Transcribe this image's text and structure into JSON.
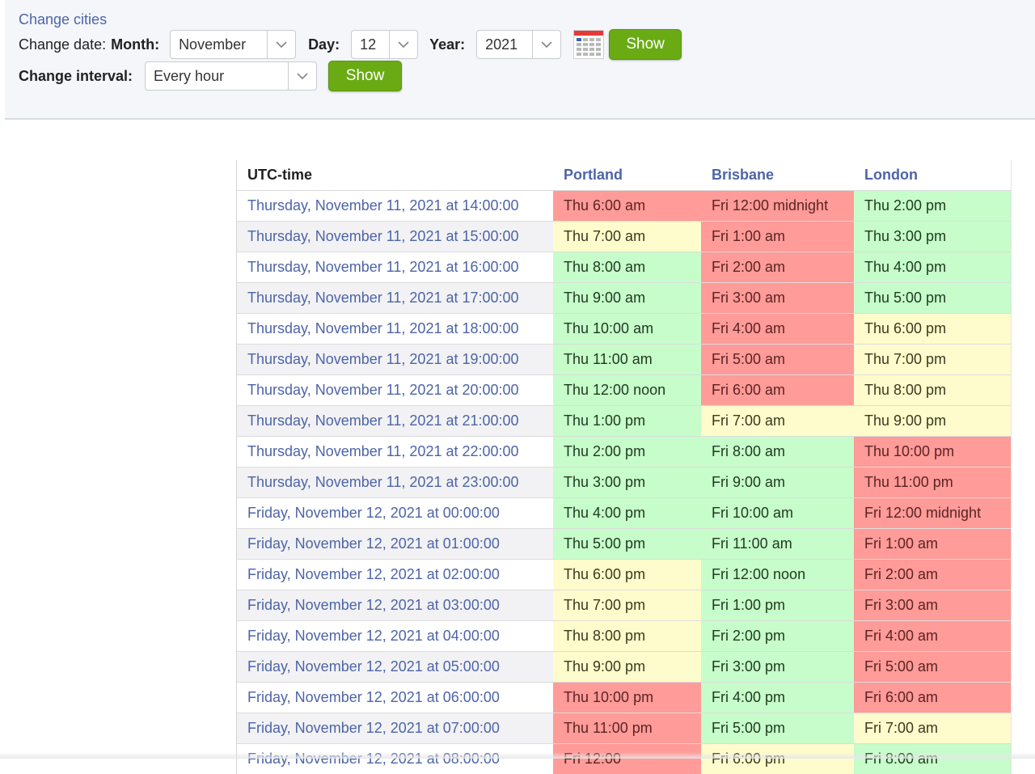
{
  "controls": {
    "change_cities_link": "Change cities",
    "change_date_label": "Change date:",
    "month_label": "Month:",
    "month_value": "November",
    "day_label": "Day:",
    "day_value": "12",
    "year_label": "Year:",
    "year_value": "2021",
    "show_date_button": "Show",
    "change_interval_label": "Change interval:",
    "interval_value": "Every hour",
    "show_interval_button": "Show"
  },
  "colors": {
    "accent_link": "#4d64a8",
    "button_green": "#6aab14",
    "cell_red": "#ff9b98",
    "cell_green": "#c7fccb",
    "cell_yellow": "#fefccc"
  },
  "table": {
    "headers": [
      "UTC-time",
      "Portland",
      "Brisbane",
      "London"
    ],
    "rows": [
      {
        "utc": "Thursday, November 11, 2021 at 14:00:00",
        "cells": [
          {
            "text": "Thu 6:00 am",
            "status": "red"
          },
          {
            "text": "Fri 12:00 midnight",
            "status": "red"
          },
          {
            "text": "Thu 2:00 pm",
            "status": "green"
          }
        ]
      },
      {
        "utc": "Thursday, November 11, 2021 at 15:00:00",
        "cells": [
          {
            "text": "Thu 7:00 am",
            "status": "yellow"
          },
          {
            "text": "Fri 1:00 am",
            "status": "red"
          },
          {
            "text": "Thu 3:00 pm",
            "status": "green"
          }
        ]
      },
      {
        "utc": "Thursday, November 11, 2021 at 16:00:00",
        "cells": [
          {
            "text": "Thu 8:00 am",
            "status": "green"
          },
          {
            "text": "Fri 2:00 am",
            "status": "red"
          },
          {
            "text": "Thu 4:00 pm",
            "status": "green"
          }
        ]
      },
      {
        "utc": "Thursday, November 11, 2021 at 17:00:00",
        "cells": [
          {
            "text": "Thu 9:00 am",
            "status": "green"
          },
          {
            "text": "Fri 3:00 am",
            "status": "red"
          },
          {
            "text": "Thu 5:00 pm",
            "status": "green"
          }
        ]
      },
      {
        "utc": "Thursday, November 11, 2021 at 18:00:00",
        "cells": [
          {
            "text": "Thu 10:00 am",
            "status": "green"
          },
          {
            "text": "Fri 4:00 am",
            "status": "red"
          },
          {
            "text": "Thu 6:00 pm",
            "status": "yellow"
          }
        ]
      },
      {
        "utc": "Thursday, November 11, 2021 at 19:00:00",
        "cells": [
          {
            "text": "Thu 11:00 am",
            "status": "green"
          },
          {
            "text": "Fri 5:00 am",
            "status": "red"
          },
          {
            "text": "Thu 7:00 pm",
            "status": "yellow"
          }
        ]
      },
      {
        "utc": "Thursday, November 11, 2021 at 20:00:00",
        "cells": [
          {
            "text": "Thu 12:00 noon",
            "status": "green"
          },
          {
            "text": "Fri 6:00 am",
            "status": "red"
          },
          {
            "text": "Thu 8:00 pm",
            "status": "yellow"
          }
        ]
      },
      {
        "utc": "Thursday, November 11, 2021 at 21:00:00",
        "cells": [
          {
            "text": "Thu 1:00 pm",
            "status": "green"
          },
          {
            "text": "Fri 7:00 am",
            "status": "yellow"
          },
          {
            "text": "Thu 9:00 pm",
            "status": "yellow"
          }
        ]
      },
      {
        "utc": "Thursday, November 11, 2021 at 22:00:00",
        "cells": [
          {
            "text": "Thu 2:00 pm",
            "status": "green"
          },
          {
            "text": "Fri 8:00 am",
            "status": "green"
          },
          {
            "text": "Thu 10:00 pm",
            "status": "red"
          }
        ]
      },
      {
        "utc": "Thursday, November 11, 2021 at 23:00:00",
        "cells": [
          {
            "text": "Thu 3:00 pm",
            "status": "green"
          },
          {
            "text": "Fri 9:00 am",
            "status": "green"
          },
          {
            "text": "Thu 11:00 pm",
            "status": "red"
          }
        ]
      },
      {
        "utc": "Friday, November 12, 2021 at 00:00:00",
        "cells": [
          {
            "text": "Thu 4:00 pm",
            "status": "green"
          },
          {
            "text": "Fri 10:00 am",
            "status": "green"
          },
          {
            "text": "Fri 12:00 midnight",
            "status": "red"
          }
        ]
      },
      {
        "utc": "Friday, November 12, 2021 at 01:00:00",
        "cells": [
          {
            "text": "Thu 5:00 pm",
            "status": "green"
          },
          {
            "text": "Fri 11:00 am",
            "status": "green"
          },
          {
            "text": "Fri 1:00 am",
            "status": "red"
          }
        ]
      },
      {
        "utc": "Friday, November 12, 2021 at 02:00:00",
        "cells": [
          {
            "text": "Thu 6:00 pm",
            "status": "yellow"
          },
          {
            "text": "Fri 12:00 noon",
            "status": "green"
          },
          {
            "text": "Fri 2:00 am",
            "status": "red"
          }
        ]
      },
      {
        "utc": "Friday, November 12, 2021 at 03:00:00",
        "cells": [
          {
            "text": "Thu 7:00 pm",
            "status": "yellow"
          },
          {
            "text": "Fri 1:00 pm",
            "status": "green"
          },
          {
            "text": "Fri 3:00 am",
            "status": "red"
          }
        ]
      },
      {
        "utc": "Friday, November 12, 2021 at 04:00:00",
        "cells": [
          {
            "text": "Thu 8:00 pm",
            "status": "yellow"
          },
          {
            "text": "Fri 2:00 pm",
            "status": "green"
          },
          {
            "text": "Fri 4:00 am",
            "status": "red"
          }
        ]
      },
      {
        "utc": "Friday, November 12, 2021 at 05:00:00",
        "cells": [
          {
            "text": "Thu 9:00 pm",
            "status": "yellow"
          },
          {
            "text": "Fri 3:00 pm",
            "status": "green"
          },
          {
            "text": "Fri 5:00 am",
            "status": "red"
          }
        ]
      },
      {
        "utc": "Friday, November 12, 2021 at 06:00:00",
        "cells": [
          {
            "text": "Thu 10:00 pm",
            "status": "red"
          },
          {
            "text": "Fri 4:00 pm",
            "status": "green"
          },
          {
            "text": "Fri 6:00 am",
            "status": "red"
          }
        ]
      },
      {
        "utc": "Friday, November 12, 2021 at 07:00:00",
        "cells": [
          {
            "text": "Thu 11:00 pm",
            "status": "red"
          },
          {
            "text": "Fri 5:00 pm",
            "status": "green"
          },
          {
            "text": "Fri 7:00 am",
            "status": "yellow"
          }
        ]
      },
      {
        "utc": "Friday, November 12, 2021 at 08:00:00",
        "cells": [
          {
            "text": "Fri 12:00",
            "status": "red"
          },
          {
            "text": "Fri 6:00 pm",
            "status": "yellow"
          },
          {
            "text": "Fri 8:00 am",
            "status": "green"
          }
        ]
      }
    ]
  }
}
